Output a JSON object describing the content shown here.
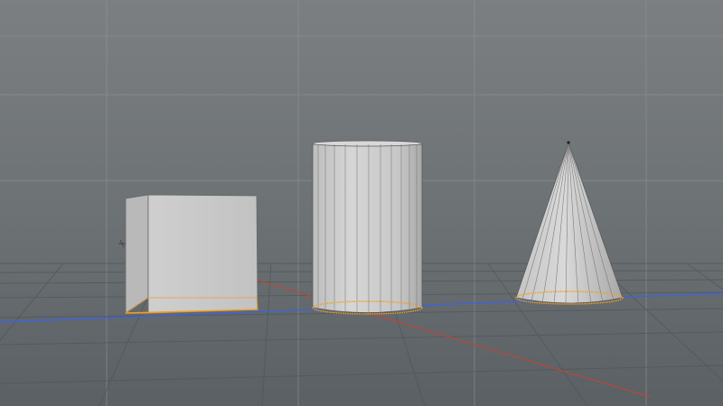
{
  "viewport": {
    "background_top": "#7d8083",
    "background_bottom": "#5e6467",
    "grid_line_color": "#9aa0a3",
    "floor_grid_color": "#4e5457",
    "x_axis_color": "#c0392b",
    "z_axis_color": "#3a5fd8",
    "object_fill": "#c9c9c9",
    "object_edge_color": "#555555",
    "selection_outline_color": "#f0a020"
  },
  "scene": {
    "objects": [
      {
        "name": "cube",
        "icon": "cube-icon",
        "selected": true
      },
      {
        "name": "cylinder",
        "icon": "cylinder-icon",
        "selected": true
      },
      {
        "name": "cone",
        "icon": "cone-icon",
        "selected": true
      }
    ]
  }
}
